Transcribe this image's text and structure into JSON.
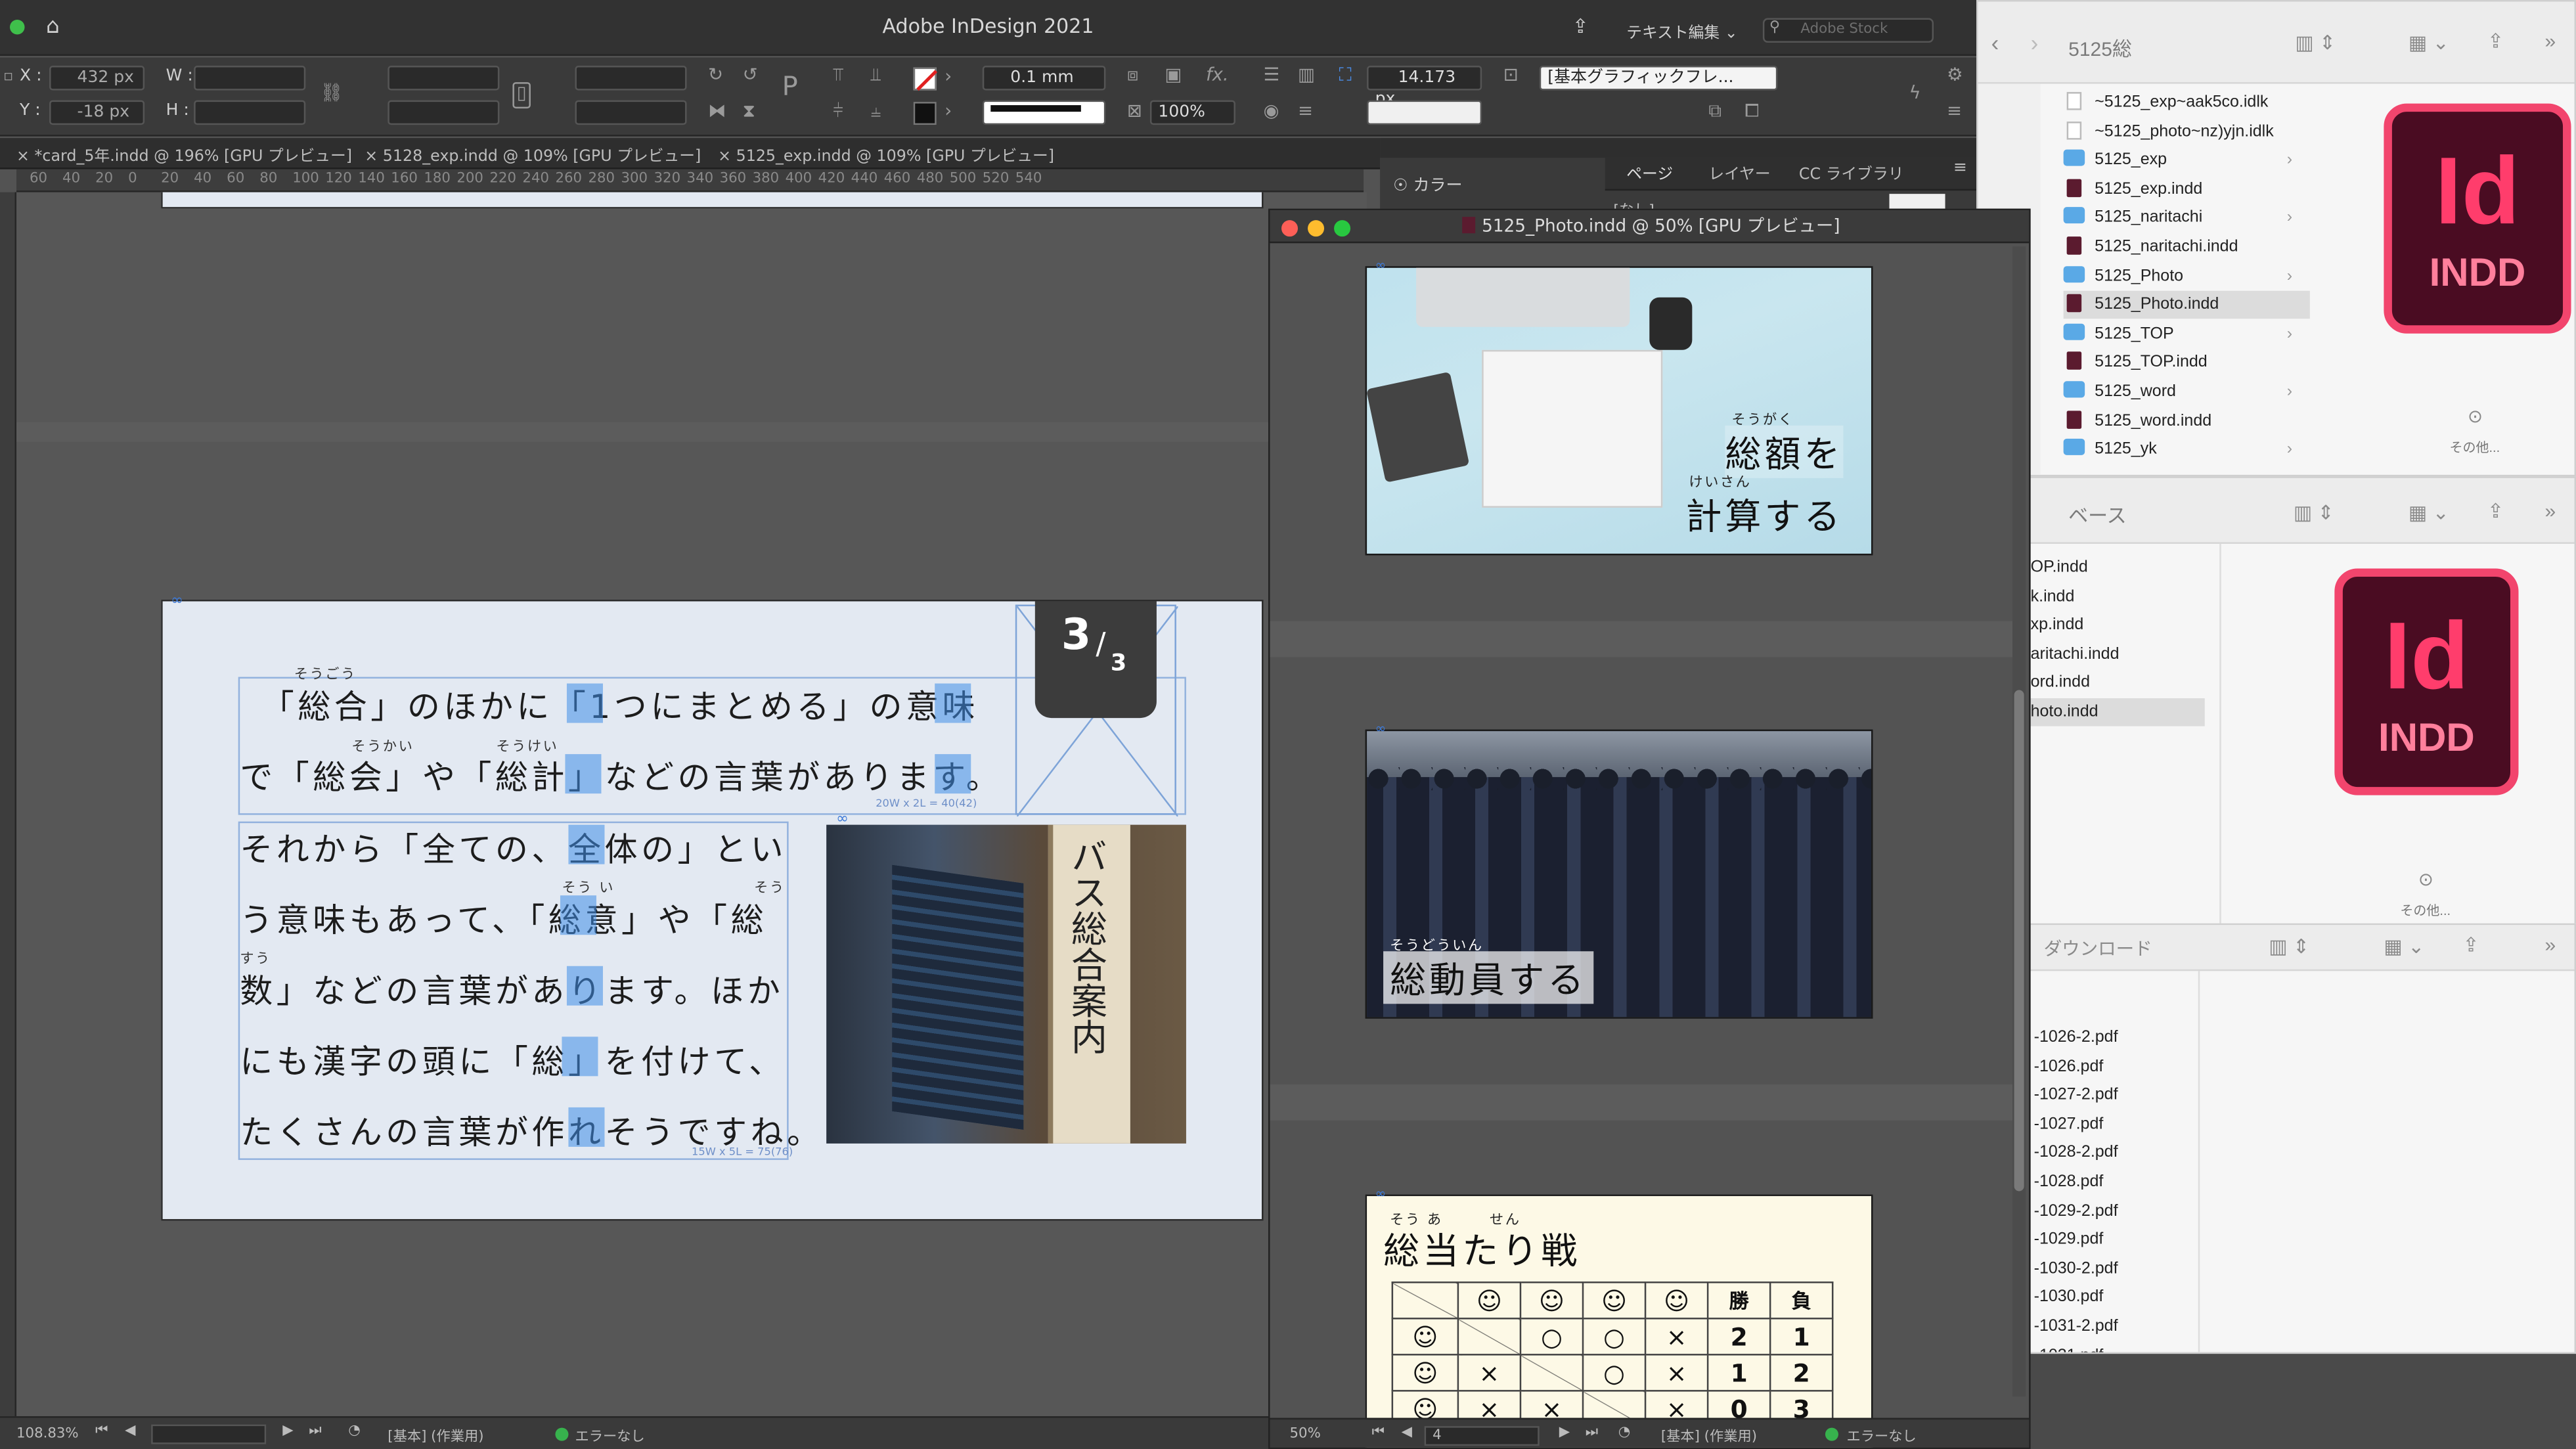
{
  "app": {
    "title": "Adobe InDesign 2021",
    "workspace_label": "テキスト編集 ⌄",
    "stock_search_placeholder": "Adobe Stock"
  },
  "control_panel": {
    "x_label": "X :",
    "x_value": "432 px",
    "y_label": "Y :",
    "y_value": "-18 px",
    "w_label": "W :",
    "h_label": "H :",
    "stroke_weight": "0.1 mm",
    "scale": "100%",
    "size_value": "14.173 px",
    "object_style": "[基本グラフィックフレ...",
    "none_label": "[なし]"
  },
  "doc_tabs": [
    "*card_5年.indd @ 196% [GPU プレビュー]",
    "5128_exp.indd @ 109% [GPU プレビュー]",
    "5125_exp.indd @ 109% [GPU プレビュー]"
  ],
  "ruler_ticks": [
    "60",
    "40",
    "20",
    "0",
    "20",
    "40",
    "60",
    "80",
    "100",
    "120",
    "140",
    "160",
    "180",
    "200",
    "220",
    "240",
    "260",
    "280",
    "300",
    "320",
    "340",
    "360",
    "380",
    "400",
    "420",
    "440",
    "460",
    "480",
    "500",
    "520",
    "540"
  ],
  "panels": {
    "color_tab": "カラー",
    "pages_tab": "ページ",
    "layers_tab": "レイヤー",
    "cc_libraries_tab": "CC ライブラリ"
  },
  "spread": {
    "badge_num": "3",
    "badge_den": "3",
    "line1": "「総合」のほかに「1つにまとめる」の意味",
    "line2": "で「総会」や「総計」などの言葉があります。",
    "line3": "それから「全ての、全体の」とい",
    "line4": "う意味もあって、「総意」や「総",
    "line5": "数」などの言葉があります。ほか",
    "line6": "にも漢字の頭に「総」を付けて、",
    "line7": "たくさんの言葉が作れそうですね。",
    "ruby_sougou": "そうごう",
    "ruby_soukai": "そうかい",
    "ruby_soukei": "そうけい",
    "ruby_soui": "そう い",
    "ruby_sou": "そう",
    "ruby_suu": "すう",
    "grid_info_1": "20W x 2L = 40(42)",
    "grid_info_2": "15W x 5L = 75(76)",
    "photo_sign": "バス総合案内"
  },
  "photo_window": {
    "title": "5125_Photo.indd @ 50% [GPU プレビュー]",
    "card1_line1": "総額を",
    "card1_line2": "計算する",
    "card1_ruby1": "そうがく",
    "card1_ruby2": "けいさん",
    "card2_text": "総動員する",
    "card2_ruby": "そうどういん",
    "card3_title": "総当たり戦",
    "card3_ruby": "そう あ　　　せん",
    "card3_headers": [
      "勝",
      "負"
    ],
    "card3_rows": [
      [
        "",
        "○",
        "○",
        "×",
        "2",
        "1"
      ],
      [
        "×",
        "",
        "○",
        "×",
        "1",
        "2"
      ],
      [
        "×",
        "×",
        "",
        "×",
        "0",
        "3"
      ]
    ],
    "zoom": "50%",
    "page_num": "4",
    "master_label": "[基本] (作業用)",
    "error_label": "エラーなし"
  },
  "statusbar": {
    "zoom": "108.83%",
    "master_label": "[基本] (作業用)",
    "error_label": "エラーなし"
  },
  "finder1": {
    "title": "5125総",
    "items": [
      {
        "name": "~5125_exp~aak5co.idlk",
        "type": "blank"
      },
      {
        "name": "~5125_photo~nz)yjn.idlk",
        "type": "blank"
      },
      {
        "name": "5125_exp",
        "type": "folder"
      },
      {
        "name": "5125_exp.indd",
        "type": "indd"
      },
      {
        "name": "5125_naritachi",
        "type": "folder"
      },
      {
        "name": "5125_naritachi.indd",
        "type": "indd"
      },
      {
        "name": "5125_Photo",
        "type": "folder"
      },
      {
        "name": "5125_Photo.indd",
        "type": "indd"
      },
      {
        "name": "5125_TOP",
        "type": "folder"
      },
      {
        "name": "5125_TOP.indd",
        "type": "indd"
      },
      {
        "name": "5125_word",
        "type": "folder"
      },
      {
        "name": "5125_word.indd",
        "type": "indd"
      },
      {
        "name": "5125_yk",
        "type": "folder"
      }
    ],
    "preview_id": "Id",
    "preview_ext": "INDD",
    "more_label": "その他..."
  },
  "finder2": {
    "title": "ベース",
    "items": [
      "OP.indd",
      "k.indd",
      "xp.indd",
      "aritachi.indd",
      "ord.indd",
      "hoto.indd"
    ],
    "preview_id": "Id",
    "preview_ext": "INDD",
    "more_label": "その他..."
  },
  "finder3": {
    "title": "ダウンロード",
    "items": [
      "-1026-2.pdf",
      "-1026.pdf",
      "-1027-2.pdf",
      "-1027.pdf",
      "-1028-2.pdf",
      "-1028.pdf",
      "-1029-2.pdf",
      "-1029.pdf",
      "-1030-2.pdf",
      "-1030.pdf",
      "-1031-2.pdf",
      "-1031.pdf"
    ]
  },
  "colors": {
    "highlight": "#3f8ee8",
    "indd_brand": "#ff3366",
    "page_bg": "#e3e9f2"
  }
}
